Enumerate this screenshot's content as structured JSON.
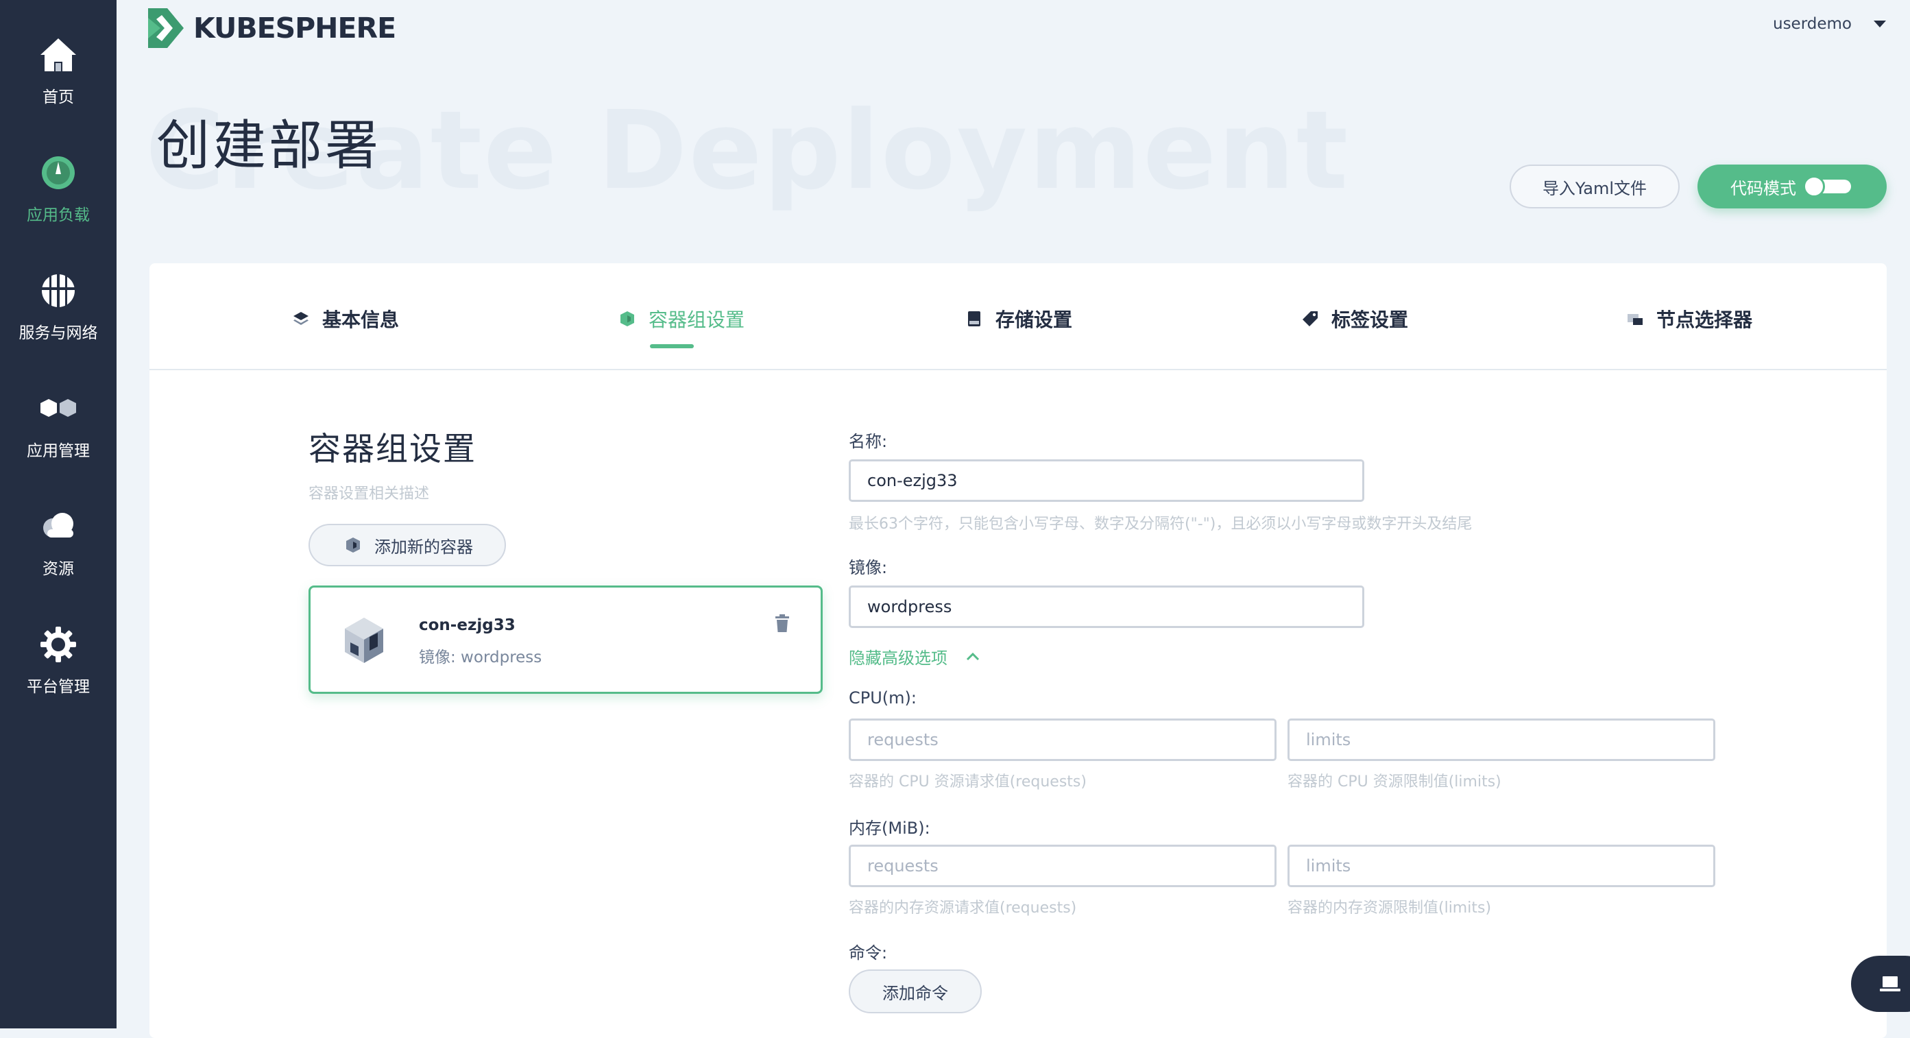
{
  "sidebar": {
    "items": [
      {
        "label": "首页",
        "icon": "home-icon",
        "active": false
      },
      {
        "label": "应用负载",
        "icon": "dashboard-icon",
        "active": true
      },
      {
        "label": "服务与网络",
        "icon": "network-icon",
        "active": false
      },
      {
        "label": "应用管理",
        "icon": "app-management-icon",
        "active": false
      },
      {
        "label": "资源",
        "icon": "cloud-icon",
        "active": false
      },
      {
        "label": "平台管理",
        "icon": "gear-icon",
        "active": false
      }
    ]
  },
  "header": {
    "logo_text": "KUBESPHERE",
    "username": "userdemo"
  },
  "page": {
    "title": "创建部署",
    "bg_title": "Create Deployment",
    "import_yaml_label": "导入Yaml文件",
    "code_mode_label": "代码模式"
  },
  "tabs": [
    {
      "label": "基本信息",
      "icon": "layers-icon",
      "active": false
    },
    {
      "label": "容器组设置",
      "icon": "container-icon",
      "active": true
    },
    {
      "label": "存储设置",
      "icon": "storage-icon",
      "active": false
    },
    {
      "label": "标签设置",
      "icon": "tag-icon",
      "active": false
    },
    {
      "label": "节点选择器",
      "icon": "node-selector-icon",
      "active": false
    }
  ],
  "section": {
    "title": "容器组设置",
    "description": "容器设置相关描述",
    "add_container_label": "添加新的容器"
  },
  "container_item": {
    "name": "con-ezjg33",
    "image_text": "镜像: wordpress"
  },
  "form": {
    "name_label": "名称:",
    "name_value": "con-ezjg33",
    "name_hint": "最长63个字符，只能包含小写字母、数字及分隔符(\"-\")，且必须以小写字母或数字开头及结尾",
    "image_label": "镜像:",
    "image_value": "wordpress",
    "advanced_toggle": "隐藏高级选项",
    "cpu_label": "CPU(m):",
    "cpu_requests_placeholder": "requests",
    "cpu_limits_placeholder": "limits",
    "cpu_requests_hint": "容器的 CPU 资源请求值(requests)",
    "cpu_limits_hint": "容器的 CPU 资源限制值(limits)",
    "memory_label": "内存(MiB):",
    "memory_requests_placeholder": "requests",
    "memory_limits_placeholder": "limits",
    "memory_requests_hint": "容器的内存资源请求值(requests)",
    "memory_limits_hint": "容器的内存资源限制值(limits)",
    "command_label": "命令:",
    "add_command_label": "添加命令"
  },
  "colors": {
    "accent": "#55bc8a",
    "sidebar_bg": "#242e42",
    "page_bg": "#eff4f9"
  }
}
